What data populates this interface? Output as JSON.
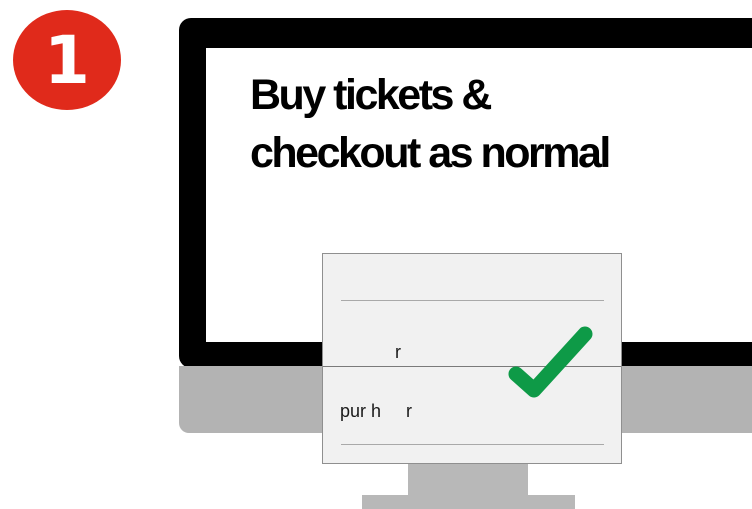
{
  "step": {
    "number": "1",
    "badge_color": "#e02a1b"
  },
  "screen": {
    "headline": "Buy tickets &\ncheckout as normal"
  },
  "receipt": {
    "line_top": "r",
    "line_bottom": "pur h     r"
  },
  "icons": {
    "check": "checkmark-icon",
    "check_color": "#0e9a47"
  }
}
